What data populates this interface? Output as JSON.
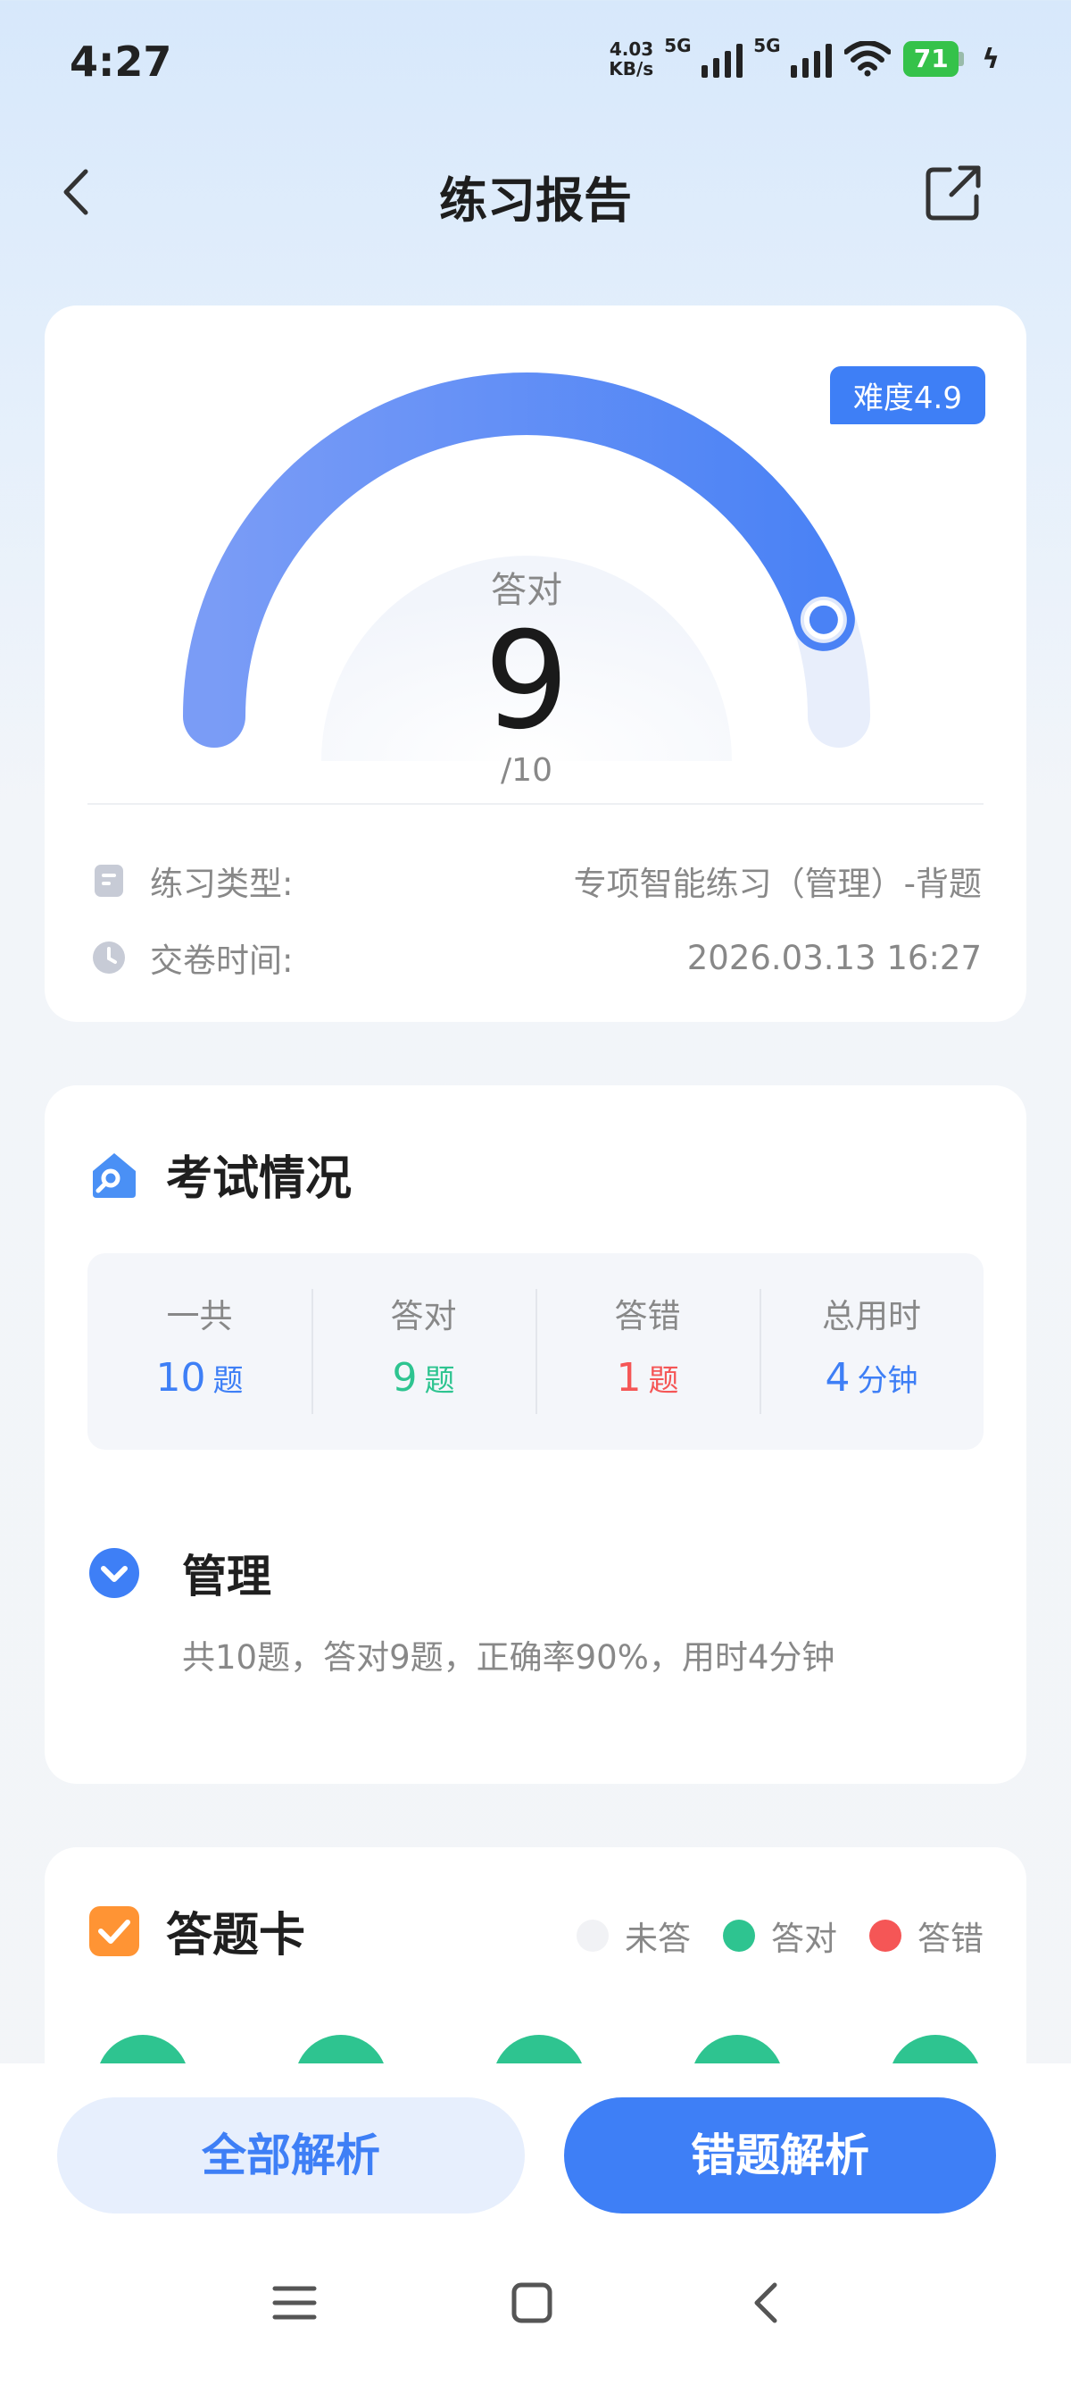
{
  "status_bar": {
    "time": "4:27",
    "net_speed_value": "4.03",
    "net_speed_unit": "KB/s",
    "sim1_label": "5G",
    "sim2_label": "5G",
    "battery_level": "71"
  },
  "header": {
    "title": "练习报告"
  },
  "score_card": {
    "difficulty": "难度4.9",
    "gauge_label": "答对",
    "correct": "9",
    "total_text": "/10",
    "correct_fraction": 0.9,
    "practice_type_label": "练习类型:",
    "practice_type_value": "专项智能练习（管理）-背题",
    "submit_time_label": "交卷时间:",
    "submit_time_value": "2026.03.13 16:27"
  },
  "exam": {
    "title": "考试情况",
    "stats": [
      {
        "label": "一共",
        "value": "10",
        "unit": "题",
        "color": "#3e7ff6"
      },
      {
        "label": "答对",
        "value": "9",
        "unit": "题",
        "color": "#2ec490"
      },
      {
        "label": "答错",
        "value": "1",
        "unit": "题",
        "color": "#f55656"
      },
      {
        "label": "总用时",
        "value": "4",
        "unit": "分钟",
        "color": "#3e7ff6"
      }
    ],
    "subject": {
      "name": "管理",
      "summary": "共10题，答对9题，正确率90%，用时4分钟"
    }
  },
  "answer_sheet": {
    "title": "答题卡",
    "legend": [
      {
        "label": "未答",
        "color": "#f1f2f5"
      },
      {
        "label": "答对",
        "color": "#2ec490"
      },
      {
        "label": "答错",
        "color": "#f55656"
      }
    ]
  },
  "buttons": {
    "all_analysis": "全部解析",
    "wrong_analysis": "错题解析"
  },
  "colors": {
    "accent": "#3e7ff6",
    "correct": "#2ec490",
    "wrong": "#f55656"
  }
}
